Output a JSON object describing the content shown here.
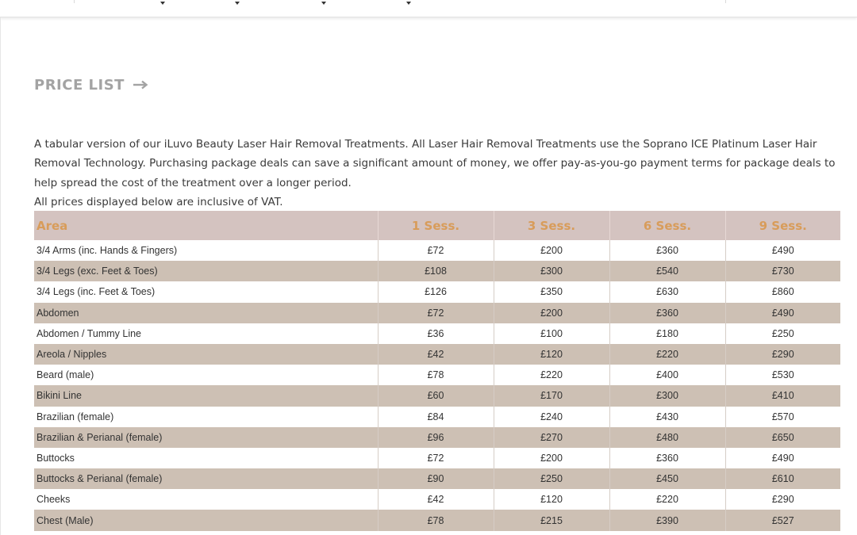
{
  "heading": {
    "title": "PRICE LIST",
    "icon": "arrow-right-icon"
  },
  "intro": {
    "paragraph": "A tabular version of our iLuvo Beauty Laser Hair Removal Treatments. All Laser Hair Removal Treatments use the Soprano ICE Platinum Laser Hair Removal Technology. Purchasing package deals can save a significant amount of money, we offer pay-as-you-go payment terms for package deals to help spread the cost of the treatment over a longer period.",
    "vat_note": "All prices displayed below are inclusive of VAT."
  },
  "price_table": {
    "headers": [
      "Area",
      "1 Sess.",
      "3 Sess.",
      "6 Sess.",
      "9 Sess."
    ],
    "rows": [
      [
        "3/4 Arms (inc. Hands & Fingers)",
        "£72",
        "£200",
        "£360",
        "£490"
      ],
      [
        "3/4 Legs (exc. Feet & Toes)",
        "£108",
        "£300",
        "£540",
        "£730"
      ],
      [
        "3/4 Legs (inc. Feet & Toes)",
        "£126",
        "£350",
        "£630",
        "£860"
      ],
      [
        "Abdomen",
        "£72",
        "£200",
        "£360",
        "£490"
      ],
      [
        "Abdomen / Tummy Line",
        "£36",
        "£100",
        "£180",
        "£250"
      ],
      [
        "Areola / Nipples",
        "£42",
        "£120",
        "£220",
        "£290"
      ],
      [
        "Beard (male)",
        "£78",
        "£220",
        "£400",
        "£530"
      ],
      [
        "Bikini Line",
        "£60",
        "£170",
        "£300",
        "£410"
      ],
      [
        "Brazilian (female)",
        "£84",
        "£240",
        "£430",
        "£570"
      ],
      [
        "Brazilian & Perianal (female)",
        "£96",
        "£270",
        "£480",
        "£650"
      ],
      [
        "Buttocks",
        "£72",
        "£200",
        "£360",
        "£490"
      ],
      [
        "Buttocks & Perianal (female)",
        "£90",
        "£250",
        "£450",
        "£610"
      ],
      [
        "Cheeks",
        "£42",
        "£120",
        "£220",
        "£290"
      ],
      [
        "Chest (Male)",
        "£78",
        "£215",
        "£390",
        "£527"
      ]
    ]
  },
  "colors": {
    "heading": "#a3a3a3",
    "table_header_bg": "#d4c3c0",
    "table_header_text": "#d89c5a",
    "row_alt_bg": "#cdc0b4"
  }
}
